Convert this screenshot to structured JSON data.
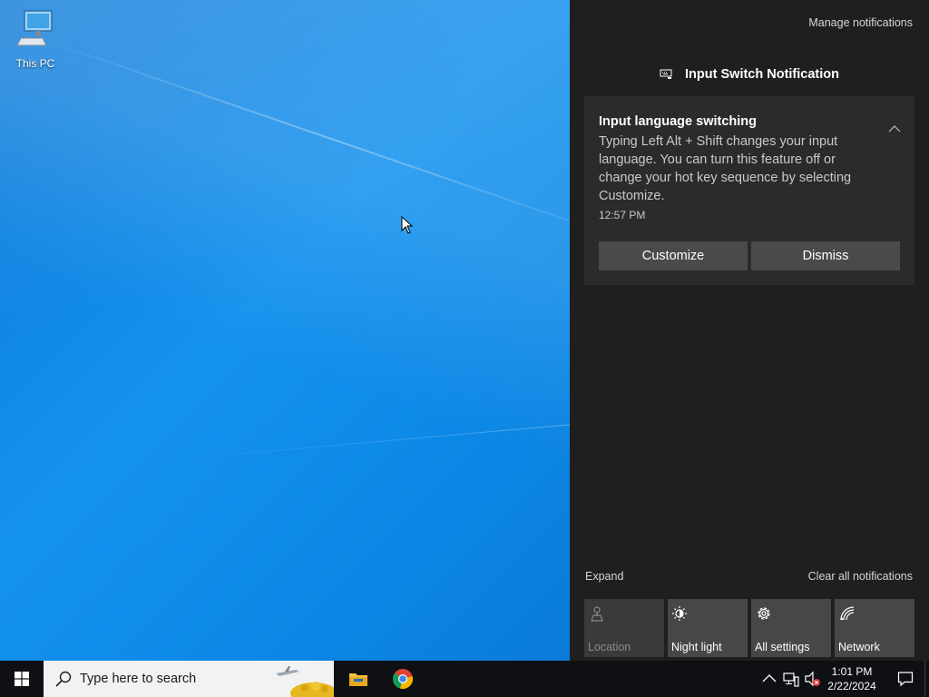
{
  "desktop": {
    "icons": [
      {
        "label": "This PC",
        "icon": "this-pc-icon"
      }
    ]
  },
  "action_center": {
    "manage_label": "Manage notifications",
    "group_title": "Input Switch Notification",
    "group_icon": "keyboard-icon",
    "toast": {
      "title": "Input language switching",
      "body": "Typing Left Alt + Shift changes your input language. You can turn this feature off or change your hot key sequence by selecting Customize.",
      "time": "12:57 PM",
      "buttons": {
        "customize": "Customize",
        "dismiss": "Dismiss"
      }
    },
    "expand_label": "Expand",
    "clear_all_label": "Clear all notifications",
    "quick_actions": [
      {
        "label": "Location",
        "icon": "location-icon",
        "enabled": false
      },
      {
        "label": "Night light",
        "icon": "night-light-icon",
        "enabled": true
      },
      {
        "label": "All settings",
        "icon": "gear-icon",
        "enabled": true
      },
      {
        "label": "Network",
        "icon": "network-icon",
        "enabled": true
      }
    ]
  },
  "taskbar": {
    "search_placeholder": "Type here to search",
    "apps": [
      {
        "name": "File Explorer",
        "icon": "file-explorer-icon"
      },
      {
        "name": "Google Chrome",
        "icon": "chrome-icon"
      }
    ],
    "clock": {
      "time": "1:01 PM",
      "date": "2/22/2024"
    }
  },
  "colors": {
    "action_center_bg": "#1f1f1f",
    "toast_bg": "#2b2b2b",
    "button_bg": "#4a4a4a",
    "tile_bg": "#474747",
    "taskbar_bg": "#0e1014",
    "desktop_blue": "#1592ee"
  }
}
